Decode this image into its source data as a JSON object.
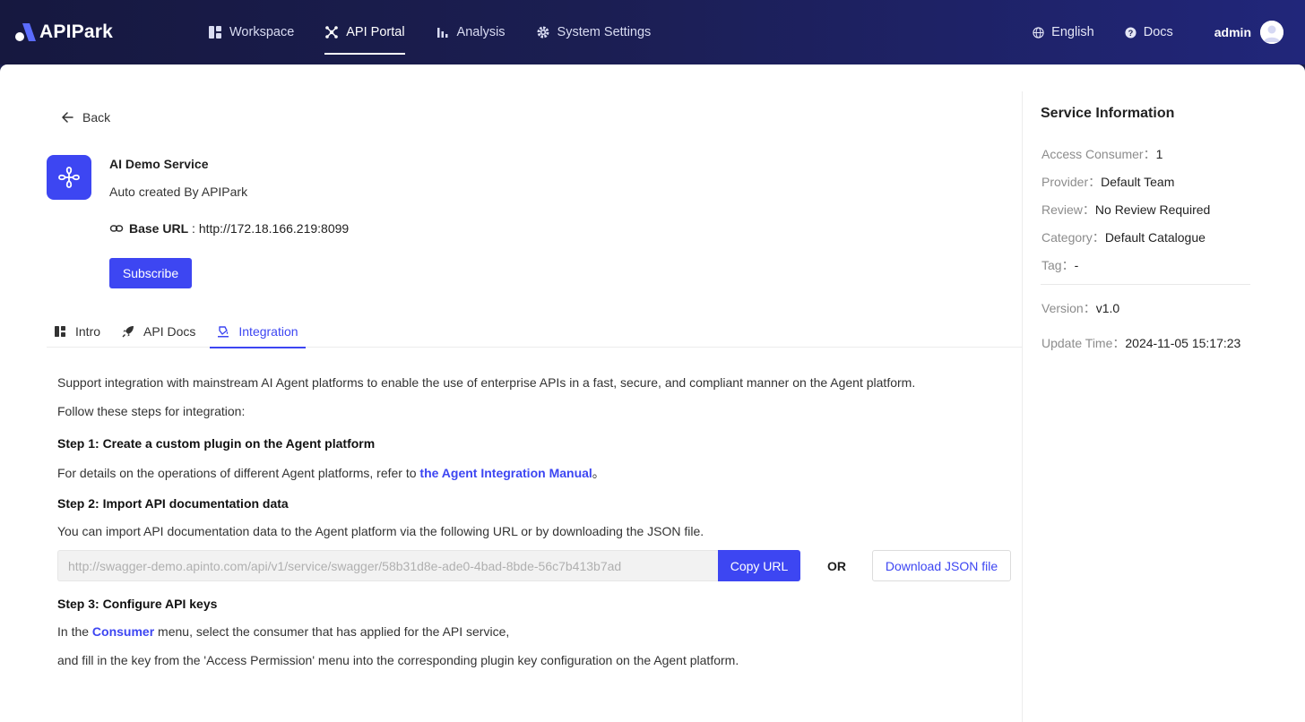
{
  "app": {
    "logo_text": "APIPark"
  },
  "nav": {
    "items": [
      {
        "label": "Workspace",
        "icon": "workspace-icon"
      },
      {
        "label": "API Portal",
        "icon": "portal-icon",
        "active": true
      },
      {
        "label": "Analysis",
        "icon": "chart-icon"
      },
      {
        "label": "System Settings",
        "icon": "gear-icon"
      }
    ],
    "language": "English",
    "docs": "Docs",
    "user": "admin"
  },
  "page": {
    "back_label": "Back",
    "service": {
      "name": "AI Demo Service",
      "description": "Auto created By APIPark",
      "base_url_label": "Base URL",
      "base_url_sep": " : ",
      "base_url": "http://172.18.166.219:8099"
    },
    "subscribe_label": "Subscribe",
    "tabs": [
      {
        "label": "Intro",
        "icon": "intro-icon"
      },
      {
        "label": "API Docs",
        "icon": "rocket-icon"
      },
      {
        "label": "Integration",
        "icon": "integration-icon",
        "active": true
      }
    ],
    "integration": {
      "intro": "Support integration with mainstream AI Agent platforms to enable the use of enterprise APIs in a fast, secure, and compliant manner on the Agent platform.",
      "follow": "Follow these steps for integration:",
      "step1_title": "Step 1: Create a custom plugin on the Agent platform",
      "step1_text": "For details on the operations of different Agent platforms, refer to ",
      "step1_link": "the Agent Integration Manual",
      "step1_end": "。",
      "step2_title": "Step 2: Import API documentation data",
      "step2_text": "You can import API documentation data to the Agent platform via the following URL or by downloading the JSON file.",
      "swagger_url": "http://swagger-demo.apinto.com/api/v1/service/swagger/58b31d8e-ade0-4bad-8bde-56c7b413b7ad",
      "copy_label": "Copy URL",
      "or_label": "OR",
      "download_label": "Download JSON file",
      "step3_title": "Step 3: Configure API keys",
      "step3_pre": "In the ",
      "step3_link": "Consumer",
      "step3_post": " menu, select the consumer that has applied for the API service,",
      "step3_line2": "and fill in the key from the 'Access Permission' menu into the corresponding plugin key configuration on the Agent platform."
    }
  },
  "sidebar": {
    "title": "Service Information",
    "rows": [
      {
        "key": "Access Consumer：",
        "value": "1"
      },
      {
        "key": "Provider：",
        "value": "Default Team"
      },
      {
        "key": "Review：",
        "value": "No Review Required"
      },
      {
        "key": "Category：",
        "value": "Default Catalogue"
      },
      {
        "key": "Tag：",
        "value": "-"
      }
    ],
    "version": {
      "key": "Version：",
      "value": "v1.0"
    },
    "update": {
      "key": "Update Time：",
      "value": "2024-11-05 15:17:23"
    }
  },
  "colors": {
    "accent": "#3d46f2",
    "nav_bg": "#1b1e52"
  }
}
